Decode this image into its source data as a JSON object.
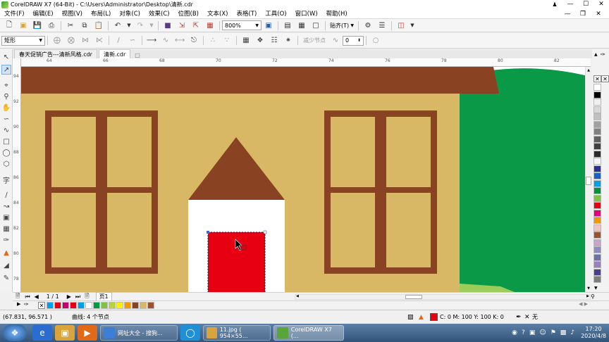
{
  "window": {
    "title": "CorelDRAW X7 (64-Bit) - C:\\Users\\Administrator\\Desktop\\清新.cdr",
    "controls": [
      "—",
      "☐",
      "✕"
    ]
  },
  "menu": [
    "文件(F)",
    "编辑(E)",
    "视图(V)",
    "布局(L)",
    "对象(C)",
    "效果(C)",
    "位图(B)",
    "文本(X)",
    "表格(T)",
    "工具(O)",
    "窗口(W)",
    "帮助(H)"
  ],
  "toolbar": {
    "zoom_value": "800%",
    "snap_label": "贴齐(T)"
  },
  "propbar": {
    "shape_select": "矩形",
    "reduce_nodes_label": "减少节点",
    "smooth_value": "0"
  },
  "doc_tabs": [
    "春天促销广告---清新风格.cdr",
    "清新.cdr"
  ],
  "ruler": {
    "h_ticks": [
      "64",
      "66",
      "68",
      "70",
      "72",
      "74",
      "76",
      "78",
      "80",
      "82"
    ],
    "v_ticks": [
      "94",
      "92",
      "90",
      "88",
      "86",
      "84",
      "82",
      "80",
      "78"
    ]
  },
  "page_nav": {
    "page_count": "1 / 1",
    "page_tab": "页1"
  },
  "status": {
    "coordinates": "(67.831, 96.571 )",
    "object_info": "曲线: 4 个节点",
    "fill_info": "C: 0 M: 100 Y: 100 K: 0",
    "outline_info": "无",
    "fill_color": "#e60012"
  },
  "taskbar": {
    "tasks": [
      {
        "label": "网址大全 - 搜狗...",
        "color": "#3d7fd6"
      },
      {
        "label": "11.jpg ( 954×55...",
        "color": "#d9a43c"
      },
      {
        "label": "CorelDRAW X7 (...",
        "color": "#58a53c"
      }
    ],
    "time": "17:20",
    "date": "2020/4/8"
  },
  "drawing": {
    "colors": {
      "wall": "#d9b865",
      "roof": "#8a4322",
      "frame": "#8a4322",
      "door": "#e60012",
      "door_frame": "#ffffff",
      "tree": "#0a9a47",
      "grass": "#9ccc5a"
    }
  },
  "palette": [
    "#ffffff",
    "#000000",
    "#f0f0f0",
    "#d8d8d8",
    "#c0c0c0",
    "#a0a0a0",
    "#808080",
    "#606060",
    "#404040",
    "#2a2a2a",
    "#f5f5f5",
    "#2b2f8f",
    "#1565c0",
    "#00a0e9",
    "#00913a",
    "#7dc242",
    "#e60012",
    "#e4007f",
    "#f39800",
    "#f7c1c1",
    "#a0522d",
    "#c8a2c8",
    "#8e8cc2",
    "#6a6fae",
    "#9a7fbf",
    "#4b3f8c",
    "#7d7d7d"
  ],
  "doc_palette": [
    "#00a0e9",
    "#e60012",
    "#c0006e",
    "#e60012",
    "#00a0e9",
    "#ffffff",
    "#009944",
    "#7dc242",
    "#b6d33c",
    "#fff100",
    "#f39800",
    "#8a4322",
    "#d9b865",
    "#a0522d"
  ]
}
